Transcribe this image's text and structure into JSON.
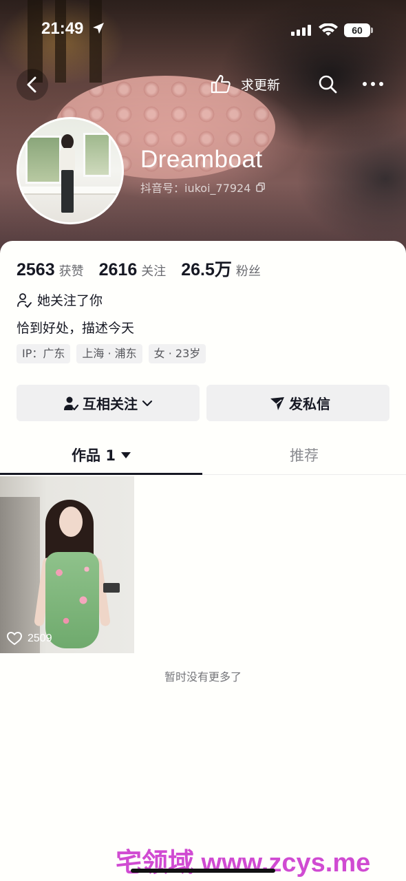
{
  "status_bar": {
    "time": "21:49",
    "battery": "60"
  },
  "nav": {
    "update_label": "求更新"
  },
  "profile": {
    "name": "Dreamboat",
    "douyin_id": "抖音号：iukoi_77924"
  },
  "stats": [
    {
      "value": "2563",
      "label": "获赞"
    },
    {
      "value": "2616",
      "label": "关注"
    },
    {
      "value": "26.5万",
      "label": "粉丝"
    }
  ],
  "follow_note": "她关注了你",
  "bio": "恰到好处，描述今天",
  "tags": [
    "IP：广东",
    "上海 · 浦东",
    "女 · 23岁"
  ],
  "buttons": {
    "mutual_follow": "互相关注",
    "message": "发私信"
  },
  "tabs": {
    "works": "作品 1",
    "recommend": "推荐"
  },
  "videos": [
    {
      "likes": "2509"
    }
  ],
  "no_more": "暂时没有更多了",
  "watermark": "宅领域 www.zcys.me",
  "colors": {
    "text": "#161823",
    "secondary": "#8a8b90",
    "button_bg": "#f0f0f1",
    "watermark": "#d04bd2"
  }
}
